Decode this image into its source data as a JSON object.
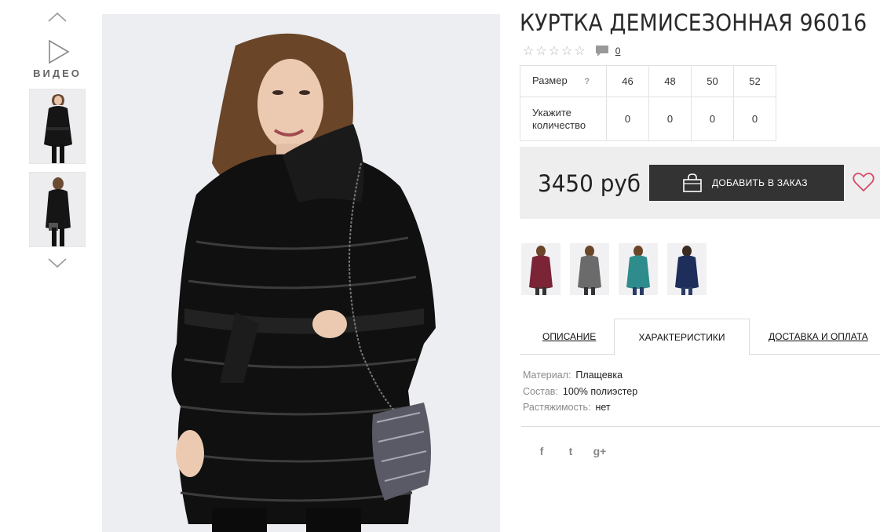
{
  "gallery": {
    "video_label": "ВИДЕО"
  },
  "product": {
    "title": "КУРТКА ДЕМИСЕЗОННАЯ 96016",
    "rating_stars": 0,
    "comment_count": "0",
    "size_table": {
      "size_label": "Размер",
      "help_mark": "?",
      "sizes": [
        "46",
        "48",
        "50",
        "52"
      ],
      "qty_label_line1": "Укажите",
      "qty_label_line2": "количество",
      "quantities": [
        "0",
        "0",
        "0",
        "0"
      ]
    },
    "price": "3450 руб",
    "add_button_label": "ДОБАВИТЬ В ЗАКАЗ"
  },
  "color_variants": [
    {
      "color": "#7a2436"
    },
    {
      "color": "#6b6b6b"
    },
    {
      "color": "#2f8c8c"
    },
    {
      "color": "#1e2e5a"
    }
  ],
  "tabs": [
    {
      "label": "ОПИСАНИЕ",
      "active": false
    },
    {
      "label": "ХАРАКТЕРИСТИКИ",
      "active": true
    },
    {
      "label": "ДОСТАВКА И ОПЛАТА",
      "active": false
    }
  ],
  "specs": [
    {
      "key": "Материал:",
      "value": "Плащевка"
    },
    {
      "key": "Состав:",
      "value": "100% полиэстер"
    },
    {
      "key": "Растяжимость:",
      "value": "нет"
    }
  ],
  "social": {
    "facebook": "f",
    "twitter": "t",
    "gplus": "g+"
  },
  "colors": {
    "button_bg": "#333333",
    "buy_box_bg": "#eeeeee",
    "heart": "#d94a6a",
    "jacket": "#111111"
  }
}
